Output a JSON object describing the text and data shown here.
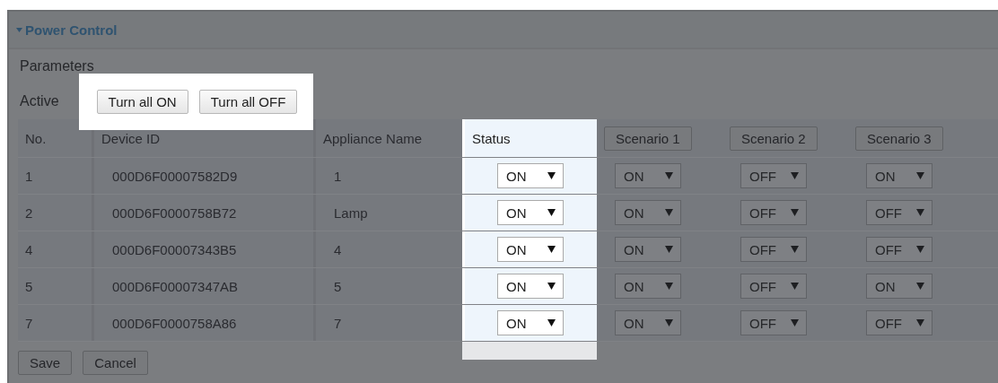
{
  "section": {
    "title": "Power Control",
    "expanded": true
  },
  "subtitle": "Parameters",
  "active_row": {
    "label": "Active",
    "highlighted": true,
    "buttons": [
      "Turn all ON",
      "Turn all OFF"
    ]
  },
  "table": {
    "columns": [
      {
        "label": "No.",
        "kind": "text",
        "highlighted": false
      },
      {
        "label": "Device ID",
        "kind": "text",
        "highlighted": false
      },
      {
        "label": "Appliance Name",
        "kind": "text",
        "highlighted": false
      },
      {
        "label": "Status",
        "kind": "select",
        "highlighted": true
      },
      {
        "label": "Scenario 1",
        "kind": "button",
        "highlighted": false
      },
      {
        "label": "Scenario 2",
        "kind": "button",
        "highlighted": false
      },
      {
        "label": "Scenario 3",
        "kind": "button",
        "highlighted": false
      }
    ],
    "rows": [
      {
        "cells": [
          "1",
          "000D6F00007582D9",
          "1",
          "ON",
          "ON",
          "OFF",
          "ON"
        ]
      },
      {
        "cells": [
          "2",
          "000D6F0000758B72",
          "Lamp",
          "ON",
          "ON",
          "OFF",
          "OFF"
        ]
      },
      {
        "cells": [
          "4",
          "000D6F00007343B5",
          "4",
          "ON",
          "ON",
          "OFF",
          "OFF"
        ]
      },
      {
        "cells": [
          "5",
          "000D6F00007347AB",
          "5",
          "ON",
          "ON",
          "OFF",
          "ON"
        ]
      },
      {
        "cells": [
          "7",
          "000D6F0000758A86",
          "7",
          "ON",
          "ON",
          "OFF",
          "OFF"
        ]
      }
    ]
  },
  "footer_buttons": [
    "Save",
    "Cancel"
  ]
}
